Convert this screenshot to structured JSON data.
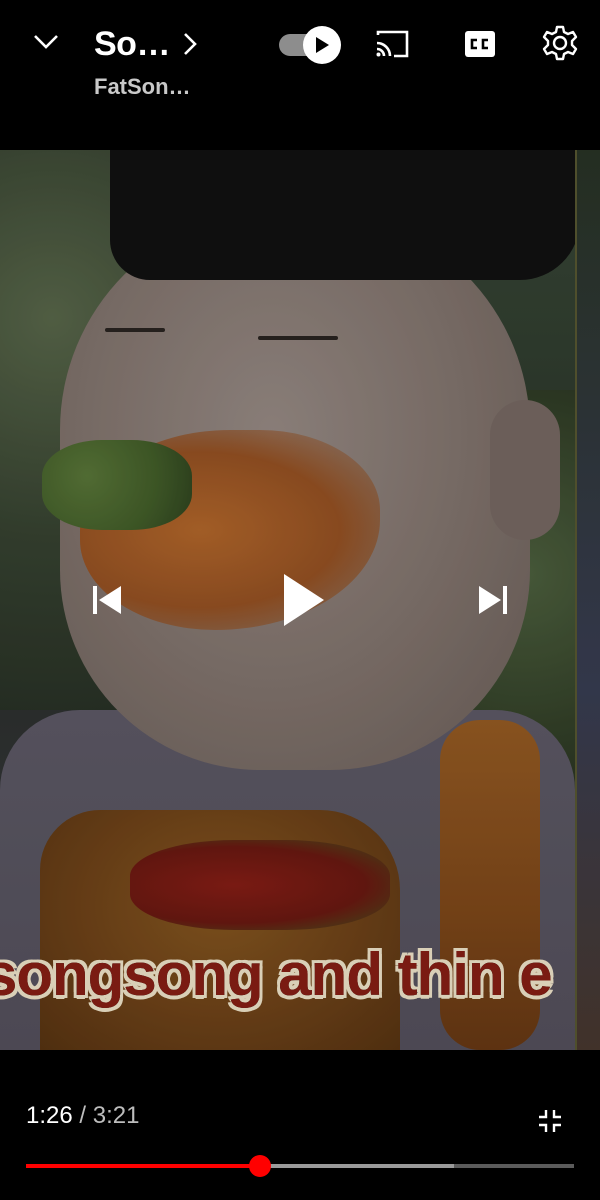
{
  "header": {
    "title": "So…",
    "channel": "FatSon…"
  },
  "player": {
    "caption_text": "songsong and thin e",
    "autoplay_on": true
  },
  "playback": {
    "current_time": "1:26",
    "separator": " / ",
    "total_time": "3:21",
    "played_fraction": 0.427,
    "buffered_fraction": 0.781
  },
  "colors": {
    "accent": "#ff0000",
    "background": "#000000"
  },
  "icons": {
    "collapse": "chevron-down-icon",
    "title_more": "chevron-right-icon",
    "autoplay": "autoplay-toggle-icon",
    "cast": "cast-icon",
    "captions": "closed-captions-icon",
    "settings": "gear-icon",
    "previous": "skip-previous-icon",
    "play": "play-icon",
    "next": "skip-next-icon",
    "fullscreen_exit": "fullscreen-exit-icon"
  }
}
